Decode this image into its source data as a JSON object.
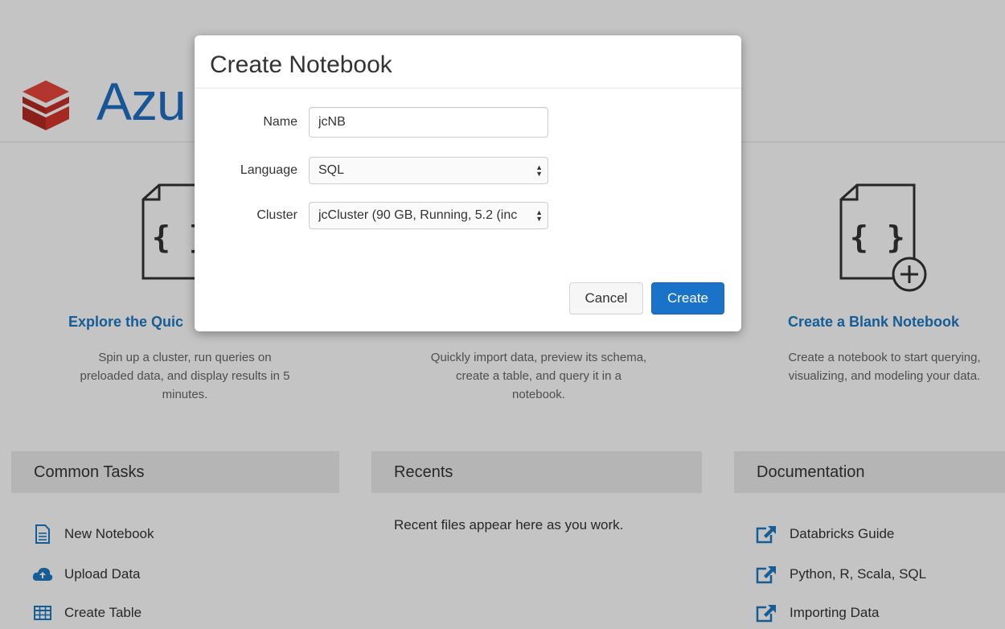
{
  "brand": {
    "name": "Azu"
  },
  "cards": {
    "left": {
      "title": "Explore the Quic",
      "description_lines": [
        "Spin up a cluster, run queries on",
        "preloaded data, and display results in 5",
        "minutes."
      ]
    },
    "middle": {
      "description_lines": [
        "Quickly import data, preview its schema,",
        "create a table, and query it in a",
        "notebook."
      ]
    },
    "right": {
      "title": "Create a Blank Notebook",
      "description_lines": [
        "Create a notebook to start querying,",
        "visualizing, and modeling your data."
      ]
    }
  },
  "sections": {
    "common_tasks": {
      "title": "Common Tasks",
      "items": [
        "New Notebook",
        "Upload Data",
        "Create Table"
      ]
    },
    "recents": {
      "title": "Recents",
      "empty_text": "Recent files appear here as you work."
    },
    "documentation": {
      "title": "Documentation",
      "items": [
        "Databricks Guide",
        "Python, R, Scala, SQL",
        "Importing Data"
      ]
    }
  },
  "modal": {
    "title": "Create Notebook",
    "name_label": "Name",
    "name_value": "jcNB",
    "language_label": "Language",
    "language_value": "SQL",
    "cluster_label": "Cluster",
    "cluster_value": "jcCluster (90 GB, Running, 5.2 (inc",
    "cancel_label": "Cancel",
    "create_label": "Create"
  },
  "colors": {
    "accent": "#1a73c8",
    "link": "#1d79c3",
    "brand": "#1f6fc5",
    "logo": "#d7362c"
  }
}
